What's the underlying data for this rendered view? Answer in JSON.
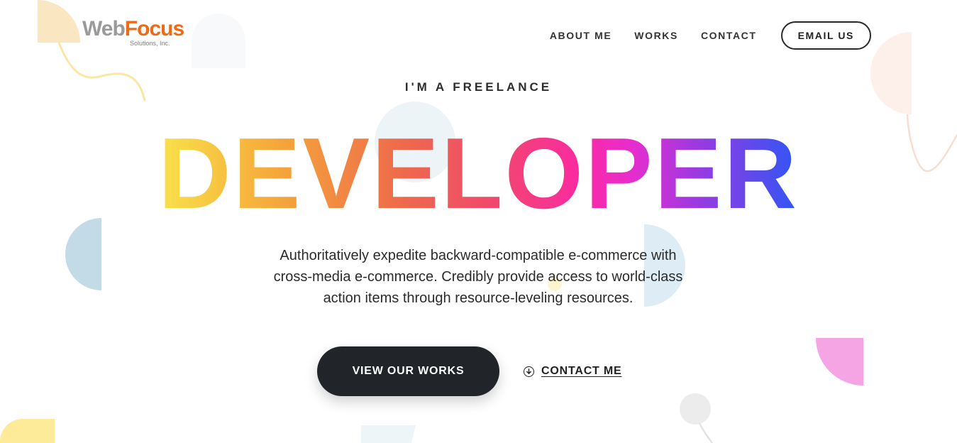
{
  "brand": {
    "logo_web": "Web",
    "logo_focus": "Focus",
    "logo_sub": "Solutions, Inc."
  },
  "nav": {
    "items": [
      {
        "label": "ABOUT ME"
      },
      {
        "label": "WORKS"
      },
      {
        "label": "CONTACT"
      }
    ],
    "email_button": "EMAIL US"
  },
  "hero": {
    "eyebrow": "I'M A FREELANCE",
    "headline": "DEVELOPER",
    "description": "Authoritatively expedite backward-compatible e-commerce with cross-media e-commerce. Credibly provide access to world-class action items through resource-leveling resources.",
    "primary_cta": "VIEW OUR WORKS",
    "secondary_cta": "CONTACT ME",
    "secondary_cta_icon": "arrow-down-circle-icon"
  },
  "colors": {
    "dark": "#212529",
    "logo_orange": "#ee6a14",
    "logo_gray": "#9a9a9a",
    "gradient": [
      "#f9e24a",
      "#f5a93a",
      "#ee6a4b",
      "#f0496b",
      "#fb2aa2",
      "#e72dce",
      "#9b3ae0",
      "#2f56f5"
    ]
  }
}
